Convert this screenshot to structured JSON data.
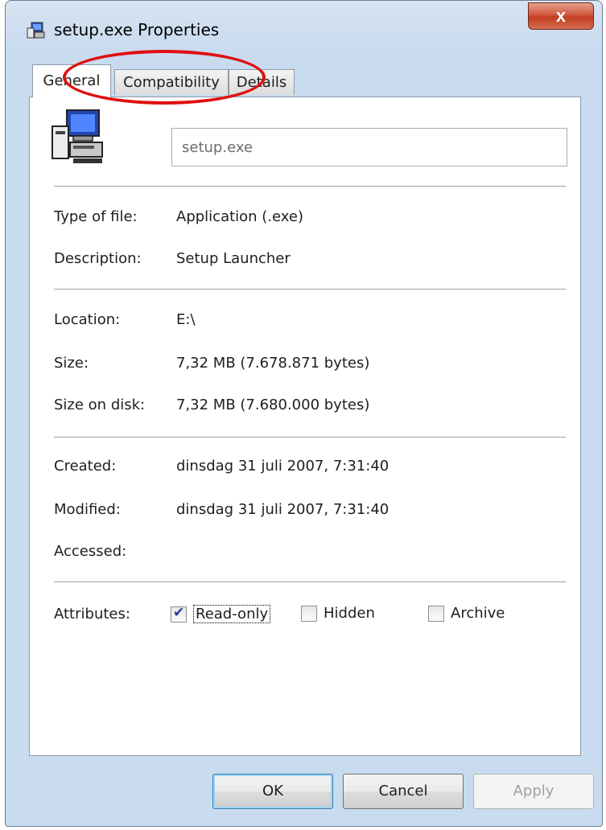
{
  "window": {
    "title": "setup.exe Properties",
    "close_label": "x",
    "app_icon": "installer-icon"
  },
  "tabs": [
    {
      "label": "General",
      "active": true
    },
    {
      "label": "Compatibility",
      "active": false
    },
    {
      "label": "Details",
      "active": false
    }
  ],
  "general": {
    "file_name": "setup.exe",
    "file_icon": "setup-computer-icon",
    "type_label": "Type of file:",
    "type_value": "Application (.exe)",
    "description_label": "Description:",
    "description_value": "Setup Launcher",
    "location_label": "Location:",
    "location_value": "E:\\",
    "size_label": "Size:",
    "size_value": "7,32 MB (7.678.871 bytes)",
    "size_on_disk_label": "Size on disk:",
    "size_on_disk_value": "7,32 MB (7.680.000 bytes)",
    "created_label": "Created:",
    "created_value": "dinsdag 31 juli 2007, 7:31:40",
    "modified_label": "Modified:",
    "modified_value": "dinsdag 31 juli 2007, 7:31:40",
    "accessed_label": "Accessed:",
    "accessed_value": "",
    "attributes_label": "Attributes:",
    "attributes": [
      {
        "label": "Read-only",
        "checked": true
      },
      {
        "label": "Hidden",
        "checked": false
      },
      {
        "label": "Archive",
        "checked": false
      }
    ]
  },
  "buttons": {
    "ok": "OK",
    "cancel": "Cancel",
    "apply": "Apply"
  },
  "colors": {
    "annotation_circle": "#e01010",
    "close_button": "#c23d22"
  }
}
